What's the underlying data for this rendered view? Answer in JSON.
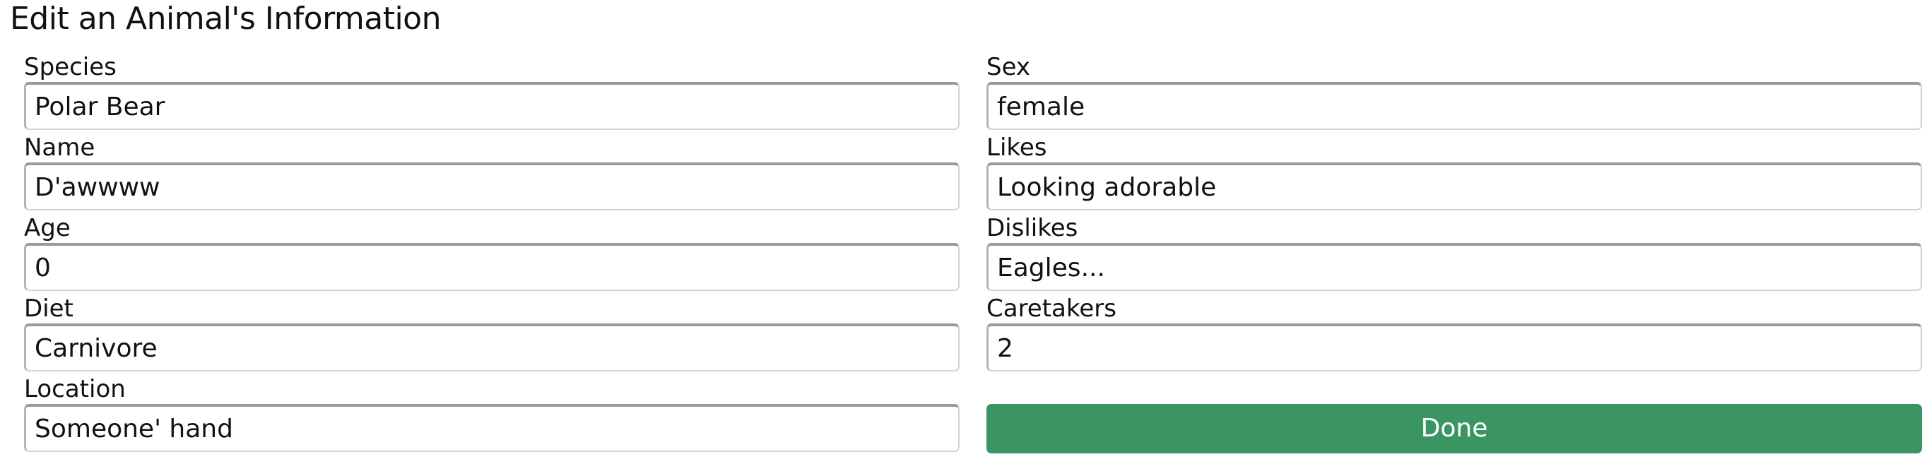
{
  "page": {
    "title": "Edit an Animal's Information"
  },
  "form": {
    "left_fields": [
      {
        "label": "Species",
        "value": "Polar Bear"
      },
      {
        "label": "Name",
        "value": "D'awwww"
      },
      {
        "label": "Age",
        "value": "0"
      },
      {
        "label": "Diet",
        "value": "Carnivore"
      },
      {
        "label": "Location",
        "value": "Someone' hand"
      }
    ],
    "right_fields": [
      {
        "label": "Sex",
        "value": "female"
      },
      {
        "label": "Likes",
        "value": "Looking adorable"
      },
      {
        "label": "Dislikes",
        "value": "Eagles..."
      },
      {
        "label": "Caretakers",
        "value": "2"
      }
    ],
    "done_button_label": "Done"
  },
  "colors": {
    "button_background": "#3a9562",
    "button_text": "#ffffff",
    "input_border": "#d4d4d4",
    "input_border_top": "#9a9a9a"
  }
}
